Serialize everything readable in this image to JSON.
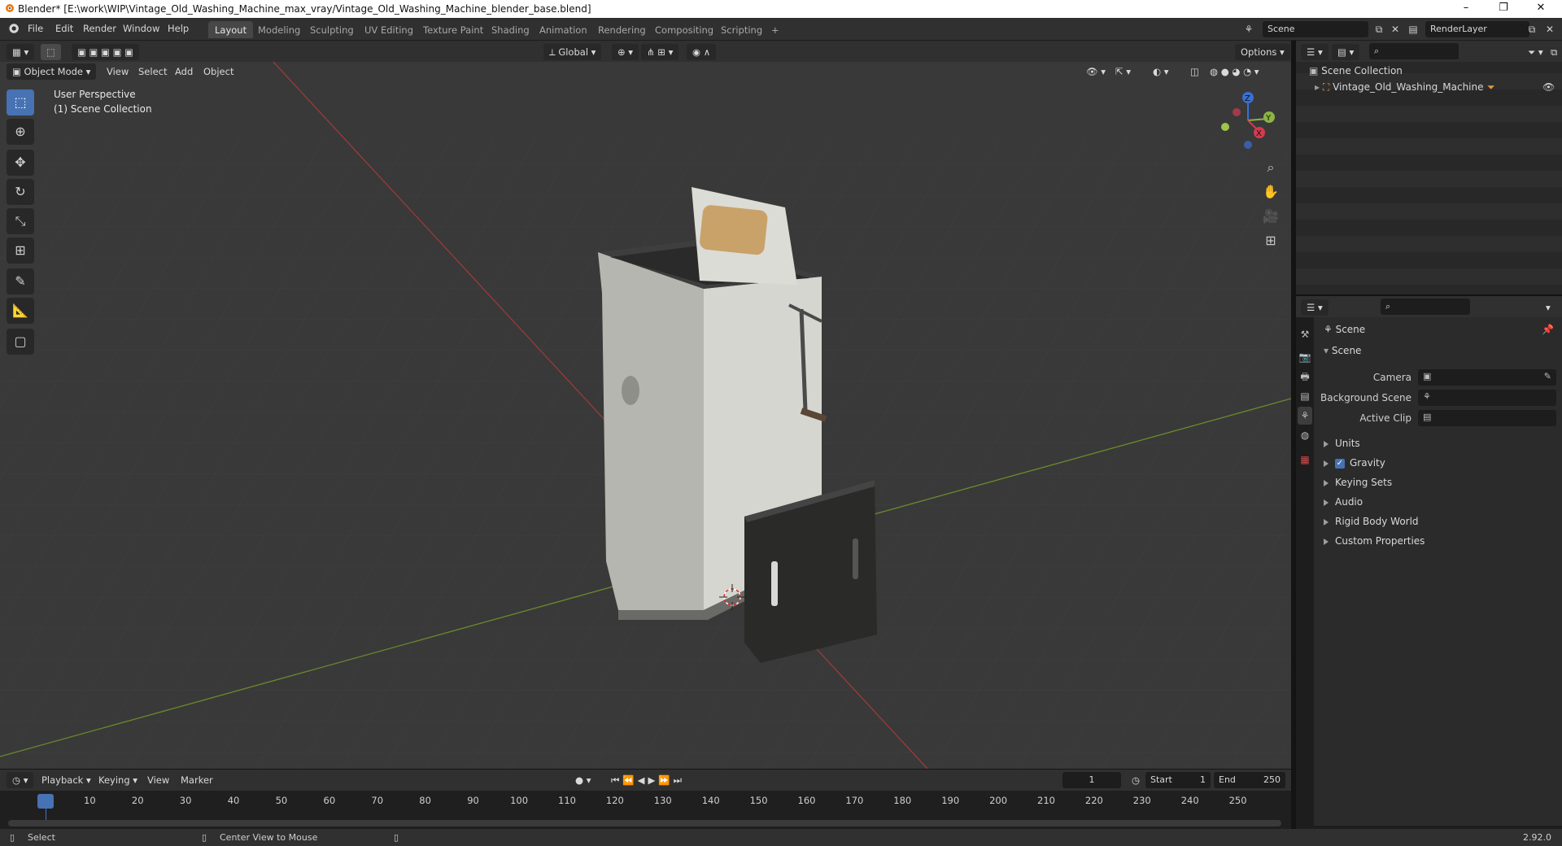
{
  "window": {
    "title": "Blender* [E:\\work\\WIP\\Vintage_Old_Washing_Machine_max_vray/Vintage_Old_Washing_Machine_blender_base.blend]",
    "minimize": "–",
    "maximize": "❐",
    "close": "✕"
  },
  "menu": [
    "File",
    "Edit",
    "Render",
    "Window",
    "Help"
  ],
  "workspaces": [
    "Layout",
    "Modeling",
    "Sculpting",
    "UV Editing",
    "Texture Paint",
    "Shading",
    "Animation",
    "Rendering",
    "Compositing",
    "Scripting"
  ],
  "workspace_add": "+",
  "scene_field": "Scene",
  "renderlayer_field": "RenderLayer",
  "viewport": {
    "transform_orientation": "Global",
    "options_label": "Options",
    "mode": "Object Mode",
    "menus": [
      "View",
      "Select",
      "Add",
      "Object"
    ],
    "overlay_title": "User Perspective",
    "overlay_collection": "(1) Scene Collection",
    "gizmo": {
      "x": "X",
      "y": "Y",
      "z": "Z"
    }
  },
  "outliner": {
    "root": "Scene Collection",
    "items": [
      {
        "label": "Vintage_Old_Washing_Machine"
      }
    ]
  },
  "properties": {
    "header": "Scene",
    "panel": "Scene",
    "fields": [
      {
        "label": "Camera"
      },
      {
        "label": "Background Scene"
      },
      {
        "label": "Active Clip"
      }
    ],
    "sections": [
      "Units",
      "Gravity",
      "Keying Sets",
      "Audio",
      "Rigid Body World",
      "Custom Properties"
    ],
    "gravity_checked": true
  },
  "timeline": {
    "menus": [
      "Playback",
      "Keying",
      "View",
      "Marker"
    ],
    "current_frame": "1",
    "start_label": "Start",
    "start_value": "1",
    "end_label": "End",
    "end_value": "250",
    "ticks": [
      "1",
      "10",
      "20",
      "30",
      "40",
      "50",
      "60",
      "70",
      "80",
      "90",
      "100",
      "110",
      "120",
      "130",
      "140",
      "150",
      "160",
      "170",
      "180",
      "190",
      "200",
      "210",
      "220",
      "230",
      "240",
      "250"
    ]
  },
  "status": {
    "left": "Select",
    "middle": "Center View to Mouse",
    "version": "2.92.0"
  }
}
